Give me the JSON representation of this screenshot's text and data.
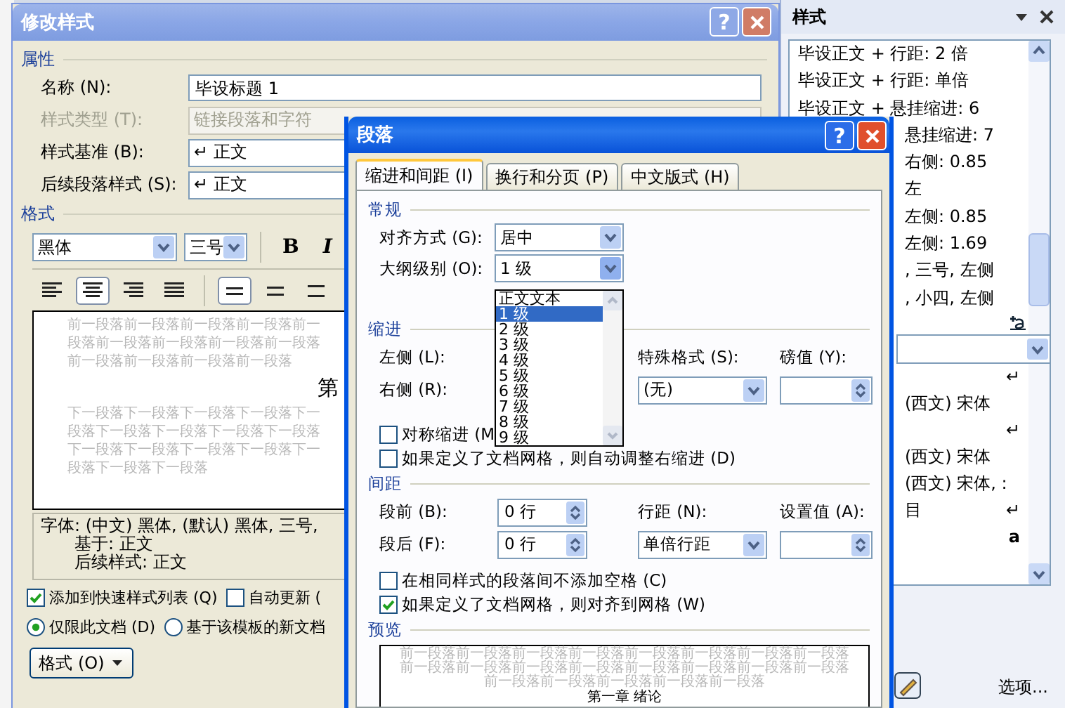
{
  "style_dialog": {
    "title": "修改样式",
    "help": "?",
    "properties": {
      "heading": "属性",
      "fields": [
        {
          "label": "名称 (N):",
          "value": "毕设标题 1",
          "kind": "text",
          "disabled": false
        },
        {
          "label": "样式类型 (T):",
          "value": "链接段落和字符",
          "kind": "combo",
          "disabled": true
        },
        {
          "label": "样式基准 (B):",
          "value": "↵ 正文",
          "kind": "combo",
          "disabled": false
        },
        {
          "label": "后续段落样式 (S):",
          "value": "↵ 正文",
          "kind": "combo",
          "disabled": false
        }
      ]
    },
    "format": {
      "heading": "格式",
      "font": "黑体",
      "size": "三号",
      "bold": "B",
      "italic": "I",
      "align_buttons": [
        {
          "kind": "left",
          "selected": false
        },
        {
          "kind": "center",
          "selected": true
        },
        {
          "kind": "right",
          "selected": false
        },
        {
          "kind": "justify",
          "selected": false
        }
      ],
      "spacing_buttons": [
        {
          "kind": "single",
          "selected": true
        },
        {
          "kind": "onehalf",
          "selected": false
        },
        {
          "kind": "double",
          "selected": false
        }
      ]
    },
    "preview": {
      "before_lines": [
        "前一段落前一段落前一段落前一段落前一",
        "段落前一段落前一段落前一段落前一段落",
        "前一段落前一段落前一段落前一段落"
      ],
      "heading": "第",
      "after_lines": [
        "下一段落下一段落下一段落下一段落下一",
        "段落下一段落下一段落下一段落下一段落",
        "下一段落下一段落下一段落下一段落下一",
        "段落下一段落下一段落"
      ]
    },
    "description": [
      "字体: (中文) 黑体, (默认) 黑体, 三号,",
      "基于: 正文",
      "后续样式: 正文"
    ],
    "checkboxes": [
      {
        "label": "添加到快速样式列表 (Q)",
        "checked": true
      },
      {
        "label": "自动更新 (",
        "checked": false
      }
    ],
    "radios": [
      {
        "label": "仅限此文档 (D)",
        "selected": true
      },
      {
        "label": "基于该模板的新文档",
        "selected": false
      }
    ],
    "format_button": "格式 (O)"
  },
  "styles_pane": {
    "title": "样式",
    "rows": [
      {
        "text": "毕设正文 + 行距: 2 倍",
        "kind": "full"
      },
      {
        "text": "毕设正文 + 行距: 单倍",
        "kind": "full"
      },
      {
        "text": "毕设正文 + 悬挂缩进: 6",
        "kind": "full"
      },
      {
        "text": "悬挂缩进: 7",
        "kind": "clipped"
      },
      {
        "text": "右侧:  0.85",
        "kind": "clipped"
      },
      {
        "text": "左",
        "kind": "clipped"
      },
      {
        "text": "左侧:  0.85",
        "kind": "clipped"
      },
      {
        "text": "左侧:  1.69",
        "kind": "clipped"
      },
      {
        "text": ", 三号, 左侧",
        "kind": "clipped"
      },
      {
        "text": ", 小四, 左侧",
        "kind": "clipped"
      }
    ],
    "lower_rows": [
      {
        "text": "",
        "mark": "↵"
      },
      {
        "text": "(西文) 宋体",
        "mark": ""
      },
      {
        "text": "",
        "mark": "↵"
      },
      {
        "text": "(西文) 宋体",
        "mark": ""
      },
      {
        "text": "(西文) 宋体, :",
        "mark": ""
      },
      {
        "text": "目",
        "mark": "↵"
      },
      {
        "text": "",
        "mark": "a"
      }
    ],
    "options_link": "选项..."
  },
  "paragraph_dialog": {
    "title": "段落",
    "help": "?",
    "tabs": [
      {
        "label": "缩进和间距 (I)",
        "selected": true
      },
      {
        "label": "换行和分页 (P)",
        "selected": false
      },
      {
        "label": "中文版式 (H)",
        "selected": false
      }
    ],
    "general": {
      "heading": "常规",
      "alignment_label": "对齐方式 (G):",
      "alignment": "居中",
      "outline_label": "大纲级别 (O):",
      "outline": "1 级",
      "outline_options": [
        {
          "label": "正文文本",
          "selected": false
        },
        {
          "label": "1 级",
          "selected": true
        },
        {
          "label": "2 级",
          "selected": false
        },
        {
          "label": "3 级",
          "selected": false
        },
        {
          "label": "4 级",
          "selected": false
        },
        {
          "label": "5 级",
          "selected": false
        },
        {
          "label": "6 级",
          "selected": false
        },
        {
          "label": "7 级",
          "selected": false
        },
        {
          "label": "8 级",
          "selected": false
        },
        {
          "label": "9 级",
          "selected": false
        }
      ]
    },
    "indent": {
      "heading": "缩进",
      "left_label": "左侧 (L):",
      "right_label": "右侧 (R):",
      "special_label": "特殊格式 (S):",
      "special": "(无)",
      "by_label": "磅值 (Y):",
      "checkboxes": [
        {
          "label": "对称缩进 (M",
          "checked": false
        },
        {
          "label": "如果定义了文档网格，则自动调整右缩进 (D)",
          "checked": false
        }
      ]
    },
    "spacing": {
      "heading": "间距",
      "before_label": "段前 (B):",
      "before": "0 行",
      "after_label": "段后 (F):",
      "after": "0 行",
      "line_label": "行距 (N):",
      "line": "单倍行距",
      "at_label": "设置值 (A):",
      "checkboxes": [
        {
          "label": "在相同样式的段落间不添加空格 (C)",
          "checked": false
        },
        {
          "label": "如果定义了文档网格，则对齐到网格 (W)",
          "checked": true
        }
      ]
    },
    "preview": {
      "heading": "预览",
      "before_lines": [
        "前一段落前一段落前一段落前一段落前一段落前一段落前一段落前一段落",
        "前一段落前一段落前一段落前一段落前一段落前一段落前一段落前一段落",
        "前一段落前一段落前一段落前一段落前一段落"
      ],
      "text": "第一章 绪论"
    }
  }
}
